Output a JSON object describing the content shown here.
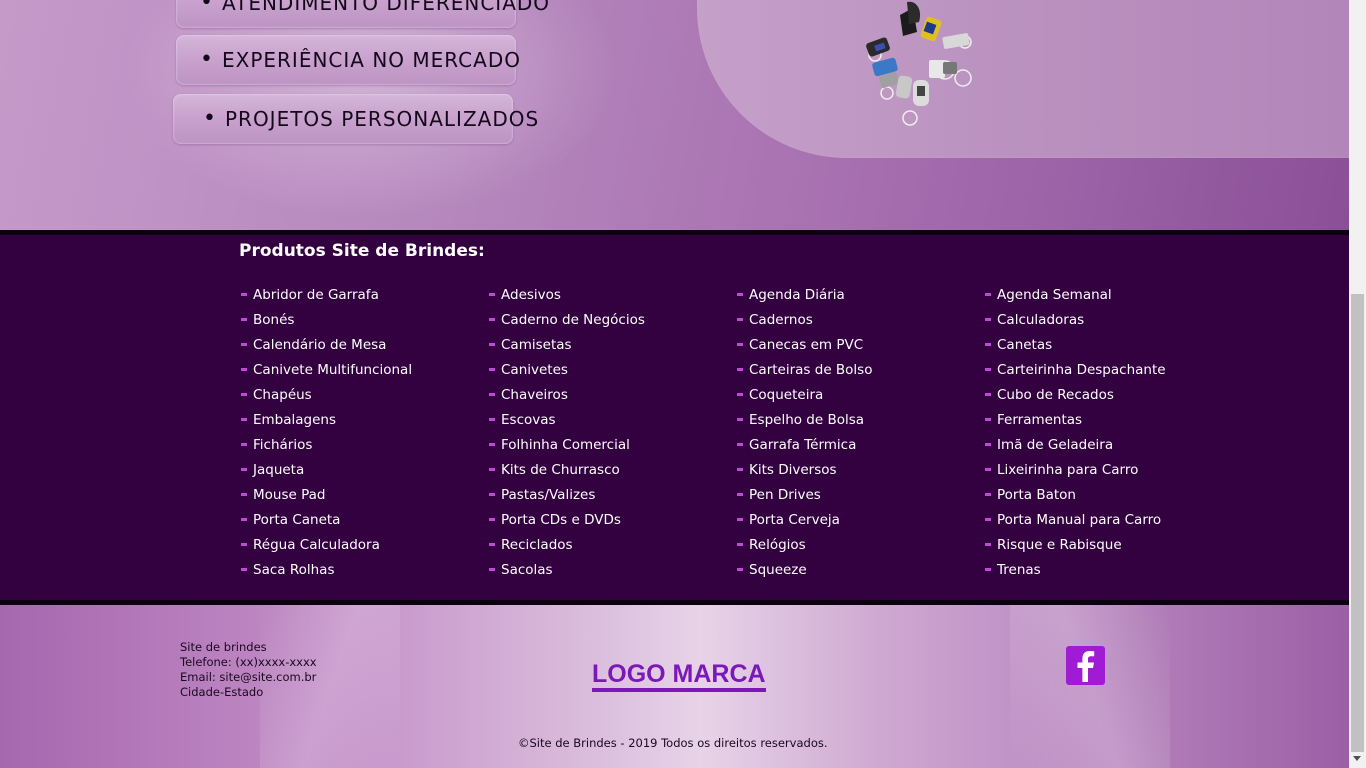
{
  "features": [
    {
      "label": "ATENDIMENTO DIFERENCIADO"
    },
    {
      "label": "EXPERIÊNCIA NO MERCADO"
    },
    {
      "label": "PROJETOS PERSONALIZADOS"
    }
  ],
  "bullet_char": "•",
  "products": {
    "title": "Produtos Site de Brindes:",
    "items": [
      "Abridor de Garrafa",
      "Adesivos",
      "Agenda Diária",
      "Agenda Semanal",
      "Bonés",
      "Caderno de Negócios",
      "Cadernos",
      "Calculadoras",
      "Calendário de Mesa",
      "Camisetas",
      "Canecas em PVC",
      "Canetas",
      "Canivete Multifuncional",
      "Canivetes",
      "Carteiras de Bolso",
      "Carteirinha Despachante",
      "Chapéus",
      "Chaveiros",
      "Coqueteira",
      "Cubo de Recados",
      "Embalagens",
      "Escovas",
      "Espelho de Bolsa",
      "Ferramentas",
      "Fichários",
      "Folhinha Comercial",
      "Garrafa Térmica",
      "Imã de Geladeira",
      "Jaqueta",
      "Kits de Churrasco",
      "Kits Diversos",
      "Lixeirinha para Carro",
      "Mouse Pad",
      "Pastas/Valizes",
      "Pen Drives",
      "Porta Baton",
      "Porta Caneta",
      "Porta CDs e DVDs",
      "Porta Cerveja",
      "Porta Manual para Carro",
      "Régua Calculadora",
      "Reciclados",
      "Relógios",
      "Risque e Rabisque",
      "Saca Rolhas",
      "Sacolas",
      "Squeeze",
      "Trenas"
    ]
  },
  "footer": {
    "contact": {
      "name": "Site de brindes",
      "phone": "Telefone: (xx)xxxx-xxxx",
      "email": "Email: site@site.com.br",
      "city": "Cidade-Estado"
    },
    "logo": "LOGO MARCA",
    "copyright": "©Site de Brindes - 2019 Todos os direitos reservados.",
    "social_icon": "facebook-icon"
  },
  "colors": {
    "products_bg": "#330040",
    "bullet": "#c04ad8",
    "logo": "#7a18b8",
    "facebook": "#a01bd4"
  }
}
